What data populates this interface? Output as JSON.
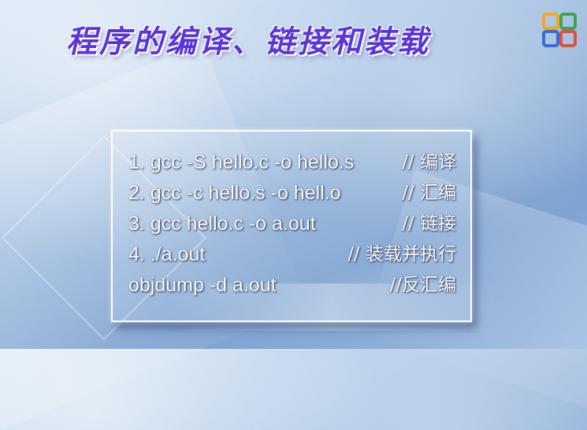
{
  "slide": {
    "title": "程序的编译、链接和装载"
  },
  "logo": {
    "icon": "four-squares-logo-icon",
    "colors": [
      "#f5a623",
      "#3aa655",
      "#2f6fd6",
      "#e84a3c"
    ]
  },
  "code_block": {
    "lines": [
      {
        "command": "1. gcc -S hello.c -o hello.s",
        "comment": "// 编译"
      },
      {
        "command": "2. gcc -c hello.s -o hell.o",
        "comment": "// 汇编"
      },
      {
        "command": "3. gcc hello.c -o a.out",
        "comment": "// 链接"
      },
      {
        "command": "4.  ./a.out",
        "comment": "// 装载并执行"
      },
      {
        "command": "objdump -d a.out",
        "comment": "//反汇编"
      }
    ]
  }
}
